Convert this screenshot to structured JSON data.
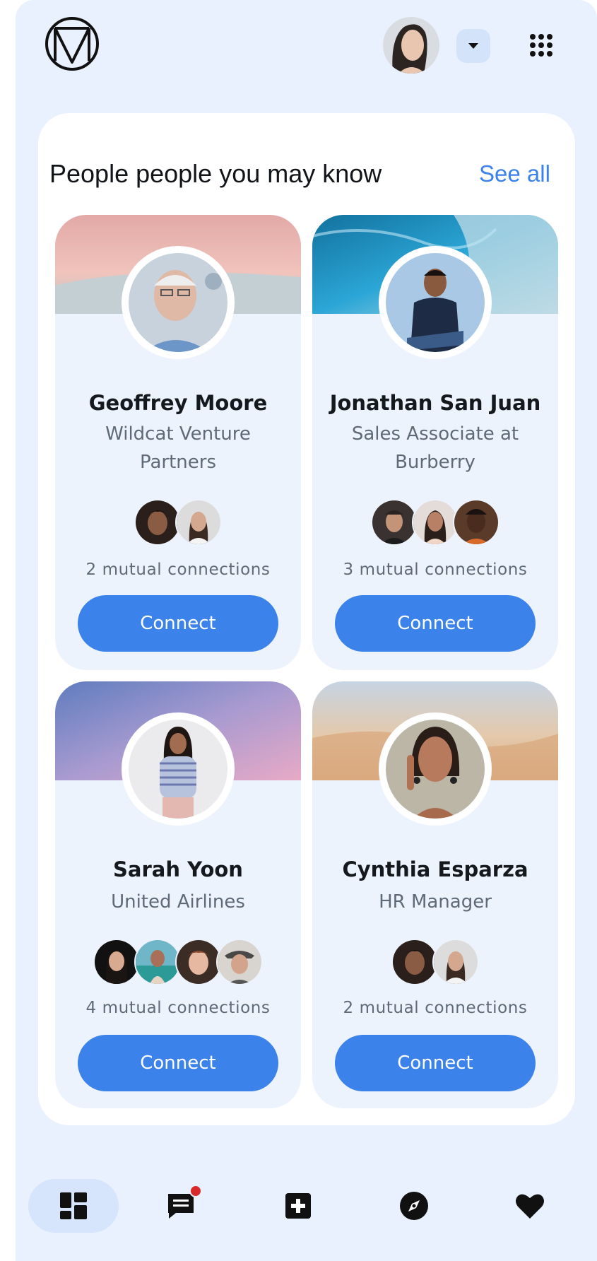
{
  "header": {
    "logo_icon": "m-circle-logo-icon",
    "avatar_icon": "user-avatar",
    "dropdown_icon": "caret-down-icon",
    "apps_icon": "apps-grid-icon"
  },
  "section": {
    "title": "People people you may know",
    "see_all_label": "See all"
  },
  "people": [
    {
      "name": "Geoffrey Moore",
      "title": "Wildcat Venture Partners",
      "mutual_count": 2,
      "mutual_text": "2 mutual connections",
      "connect_label": "Connect",
      "cover_colors": [
        "#e9b4ad",
        "#f3c4bb",
        "#b8c6cc"
      ],
      "mutual_avatar_colors": [
        "#5a3b2c",
        "#c9b5a6"
      ]
    },
    {
      "name": "Jonathan San Juan",
      "title": "Sales Associate at Burberry",
      "mutual_count": 3,
      "mutual_text": "3 mutual connections",
      "connect_label": "Connect",
      "cover_colors": [
        "#1a84b8",
        "#3ab0d8",
        "#b8d8e4"
      ],
      "mutual_avatar_colors": [
        "#3a3230",
        "#a07a66",
        "#4a2f22"
      ]
    },
    {
      "name": "Sarah Yoon",
      "title": "United Airlines",
      "mutual_count": 4,
      "mutual_text": "4 mutual connections",
      "connect_label": "Connect",
      "cover_colors": [
        "#6a86c4",
        "#a79bd0",
        "#e2a9c8"
      ],
      "mutual_avatar_colors": [
        "#2a2422",
        "#3fa8a4",
        "#d09a84",
        "#6a6866"
      ]
    },
    {
      "name": "Cynthia Esparza",
      "title": "HR Manager",
      "mutual_count": 2,
      "mutual_text": "2 mutual connections",
      "connect_label": "Connect",
      "cover_colors": [
        "#c9d4e0",
        "#e7c9a8",
        "#dfb48c"
      ],
      "mutual_avatar_colors": [
        "#5a3b2c",
        "#c9b5a6"
      ]
    }
  ],
  "nav": [
    {
      "name": "dashboard",
      "icon": "dashboard-icon",
      "active": true
    },
    {
      "name": "messages",
      "icon": "chat-icon",
      "active": false,
      "has_notification": true
    },
    {
      "name": "create",
      "icon": "plus-square-icon",
      "active": false
    },
    {
      "name": "explore",
      "icon": "compass-icon",
      "active": false
    },
    {
      "name": "favorites",
      "icon": "heart-icon",
      "active": false
    }
  ],
  "colors": {
    "accent": "#3b82ea",
    "app_background": "#e8f1fd",
    "card_background": "#edf3fd",
    "notification": "#d82a2a"
  }
}
